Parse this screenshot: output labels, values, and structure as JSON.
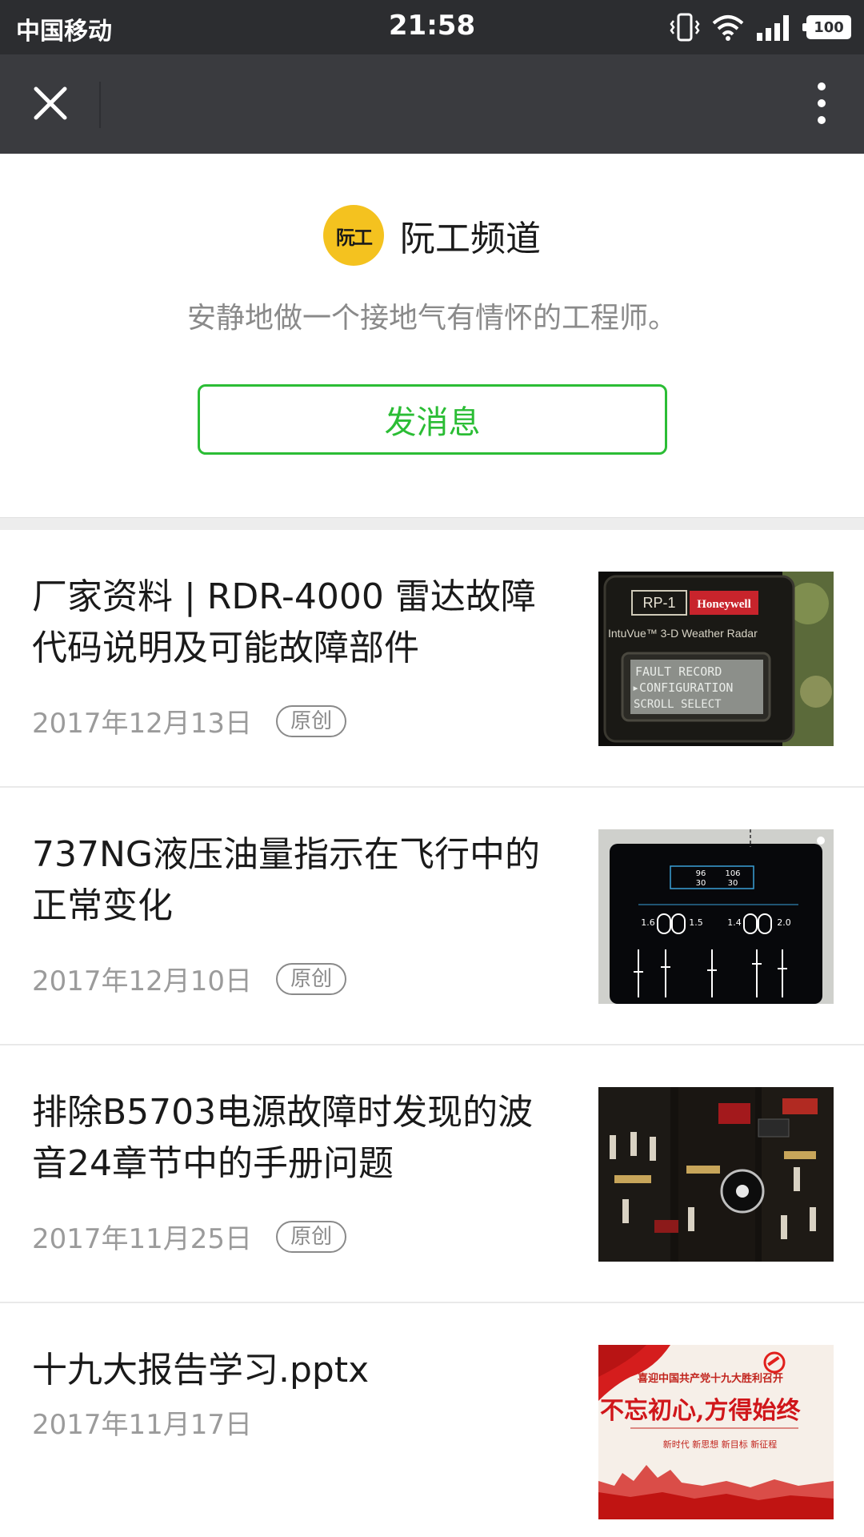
{
  "status_bar": {
    "carrier": "中国移动",
    "time": "21:58",
    "battery": "100",
    "icons": [
      "vibrate-icon",
      "wifi-icon",
      "signal-icon",
      "battery-icon"
    ]
  },
  "nav": {
    "close_icon": "close-icon",
    "more_icon": "more-vertical-icon"
  },
  "profile": {
    "avatar_text": "阮工",
    "name": "阮工频道",
    "signature": "安静地做一个接地气有情怀的工程师。",
    "send_button": "发消息"
  },
  "articles": [
    {
      "title": "厂家资料 | RDR-4000 雷达故障代码说明及可能故障部件",
      "date": "2017年12月13日",
      "badge": "原创",
      "thumb": {
        "panel_label": "RP-1",
        "brand": "Honeywell",
        "subtitle": "IntuVue™ 3-D Weather Radar",
        "screen_lines": [
          "FAULT RECORD",
          "▸CONFIGURATION",
          "SCROLL     SELECT"
        ]
      }
    },
    {
      "title": "737NG液压油量指示在飞行中的正常变化",
      "date": "2017年12月10日",
      "badge": "原创",
      "thumb": {
        "values": [
          "96",
          "106",
          "30",
          "30",
          "1.6",
          "1.5",
          "1.4",
          "2.0"
        ]
      }
    },
    {
      "title": "排除B5703电源故障时发现的波音24章节中的手册问题",
      "date": "2017年11月25日",
      "badge": "原创",
      "thumb": {}
    },
    {
      "title": "十九大报告学习.pptx",
      "date": "2017年11月17日",
      "badge": "",
      "thumb": {
        "headline": "喜迎中国共产党十九大胜利召开",
        "slogan": "不忘初心,方得始终",
        "tagline": "新时代 新思想 新目标 新征程"
      }
    }
  ],
  "colors": {
    "status_bar": "#2c2d30",
    "nav_bar": "#3a3b3f",
    "accent_green": "#2bbd35",
    "avatar_yellow": "#f4c21f"
  }
}
